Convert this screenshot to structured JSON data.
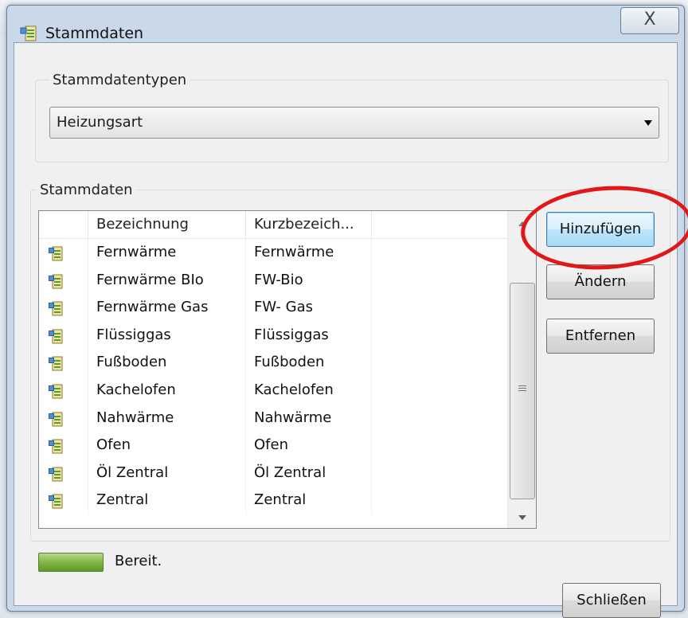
{
  "window": {
    "title": "Stammdaten",
    "close_glyph": "X"
  },
  "types_group": {
    "legend": "Stammdatentypen",
    "selected": "Heizungsart"
  },
  "data_group": {
    "legend": "Stammdaten",
    "columns": [
      "Bezeichnung",
      "Kurzbezeich..."
    ],
    "rows": [
      {
        "name": "Fernwärme",
        "short": "Fernwärme"
      },
      {
        "name": "Fernwärme BIo",
        "short": "FW-Bio"
      },
      {
        "name": "Fernwärme Gas",
        "short": "FW- Gas"
      },
      {
        "name": "Flüssiggas",
        "short": "Flüssiggas"
      },
      {
        "name": "Fußboden",
        "short": "Fußboden"
      },
      {
        "name": "Kachelofen",
        "short": "Kachelofen"
      },
      {
        "name": "Nahwärme",
        "short": "Nahwärme"
      },
      {
        "name": "Ofen",
        "short": "Ofen"
      },
      {
        "name": "Öl Zentral",
        "short": "Öl Zentral"
      },
      {
        "name": "Zentral",
        "short": "Zentral"
      }
    ]
  },
  "buttons": {
    "add": "Hinzufügen",
    "edit": "Ändern",
    "remove": "Entfernen",
    "close": "Schließen"
  },
  "status": {
    "text": "Bereit."
  },
  "colors": {
    "highlight": "#e11818",
    "progress": "#7cb342"
  }
}
